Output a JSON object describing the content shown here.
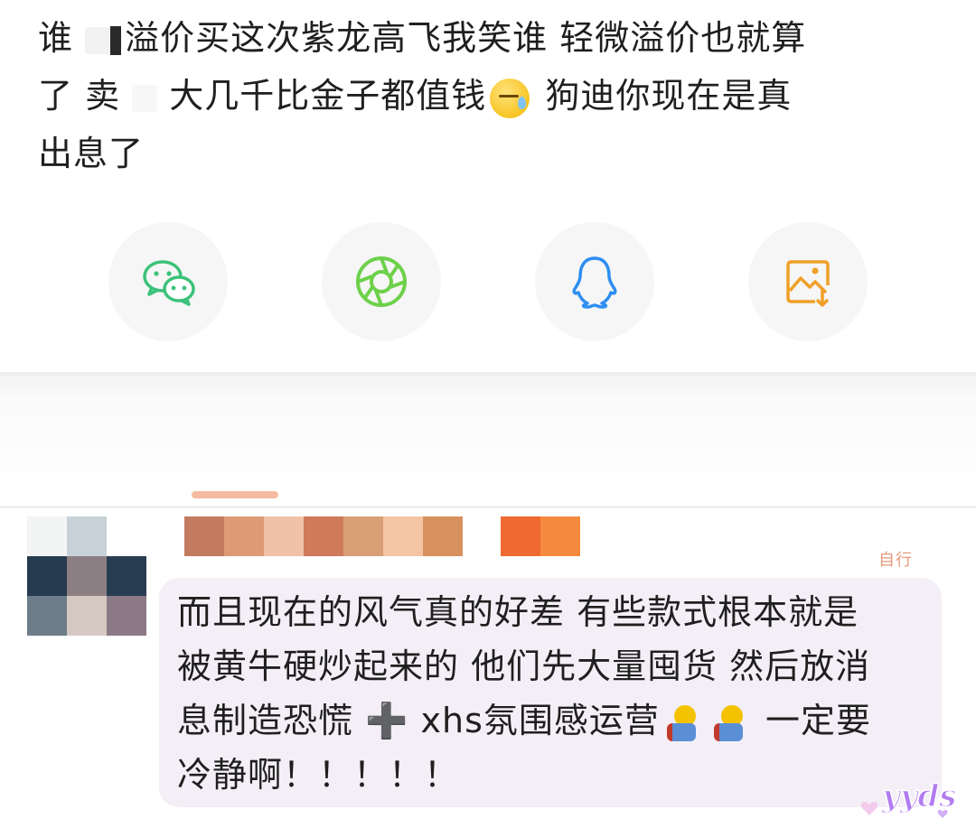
{
  "top_comment": {
    "line1": "谁",
    "line1_rest": "溢价买这次紫龙高飞我笑谁 轻微溢价也就算",
    "line2_start": "了 卖",
    "line2_rest": "大几千比金子都值钱",
    "line2_end": " 狗迪你现在是真",
    "line3": "出息了"
  },
  "share_options": [
    {
      "name": "wechat",
      "icon": "wechat-icon",
      "color": "#3cc27a"
    },
    {
      "name": "moments",
      "icon": "moments-icon",
      "color": "#6dd14a"
    },
    {
      "name": "qq",
      "icon": "qq-icon",
      "color": "#2e8ef2"
    },
    {
      "name": "save-image",
      "icon": "save-image-icon",
      "color": "#f0a028"
    }
  ],
  "reply": {
    "faint_tag": "自行",
    "line1": "而且现在的风气真的好差 有些款式根本就是",
    "line2": "被黄牛硬炒起来的 他们先大量囤货 然后放消",
    "line3_start": "息制造恐慌 ",
    "plus": "➕",
    "line3_mid": " xhs氛围感运营",
    "line3_end": " 一定要",
    "line4": "冷静啊！！！！！",
    "colors": {
      "bubble": "#f4eff6",
      "username_pixels": [
        "#c27b5e",
        "#dc9a76",
        "#f0c3a8",
        "#cf7b5a",
        "#d9a075",
        "#f4c4a3",
        "#d8905e"
      ],
      "badge_pixels": [
        "#ee6a30",
        "#f58a3e"
      ],
      "avatar_pixels": [
        "#f3f5f4",
        "#c7d1d8",
        "#ffffff",
        "#263b4f",
        "#8b7f83",
        "#283d52",
        "#6c7c89",
        "#d6c8c3",
        "#8b7a85"
      ]
    }
  },
  "watermark": {
    "text": "yyds",
    "color": "#b27cf0"
  }
}
